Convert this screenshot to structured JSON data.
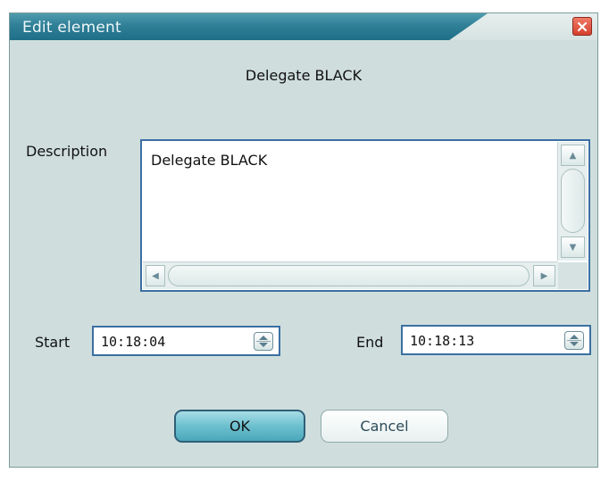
{
  "window": {
    "title": "Edit element",
    "close_icon": "close-icon"
  },
  "element_name": "Delegate BLACK",
  "description": {
    "label": "Description",
    "value": "Delegate BLACK",
    "scroll_up_glyph": "▲",
    "scroll_down_glyph": "▼",
    "scroll_left_glyph": "◀",
    "scroll_right_glyph": "▶"
  },
  "start": {
    "label": "Start",
    "value": "10:18:04"
  },
  "end": {
    "label": "End",
    "value": "10:18:13"
  },
  "buttons": {
    "ok": "OK",
    "cancel": "Cancel"
  },
  "colors": {
    "title_bar": "#2f7f97",
    "dialog_background": "#cfdedd",
    "close_button": "#d6402e",
    "field_border": "#3c6fa3",
    "ok_button": "#6cc0cf"
  }
}
